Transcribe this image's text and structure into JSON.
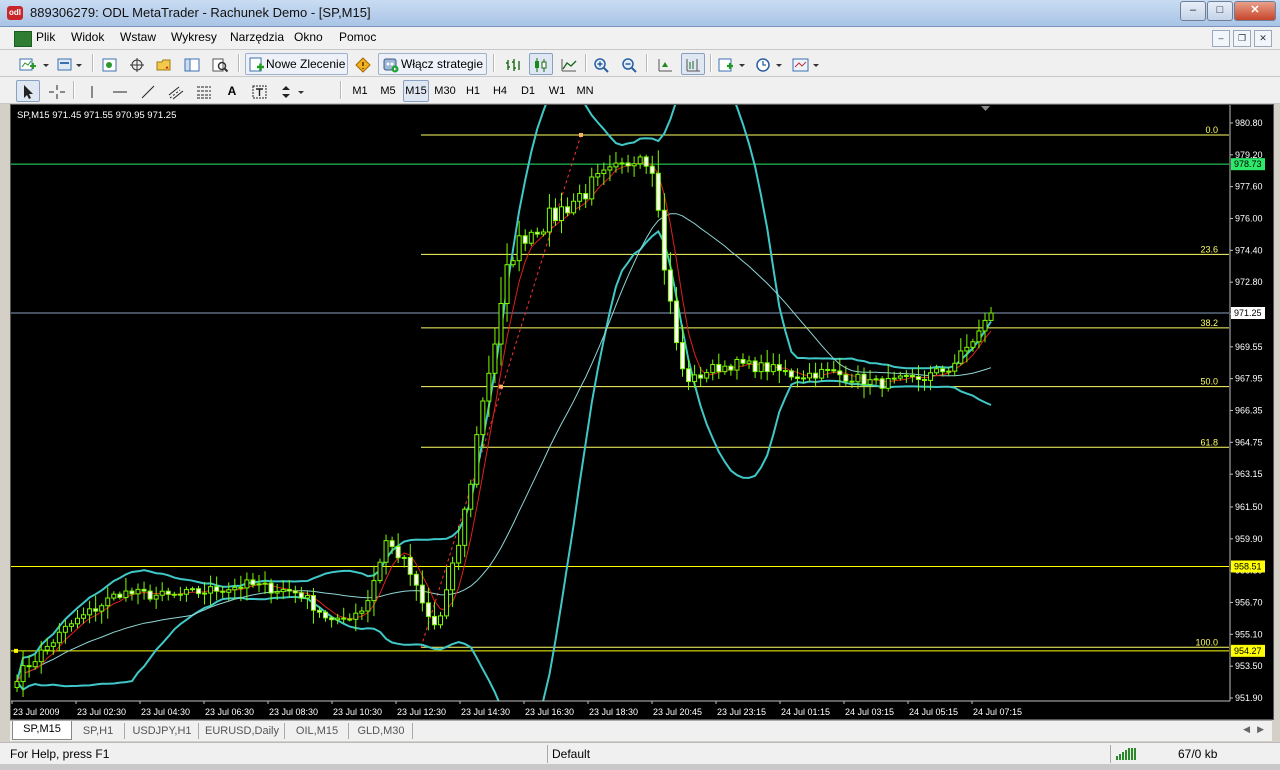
{
  "window": {
    "title": "889306279: ODL MetaTrader - Rachunek Demo - [SP,M15]",
    "icon": "metatrader-app-icon"
  },
  "menu": {
    "items": [
      "Plik",
      "Widok",
      "Wstaw",
      "Wykresy",
      "Narzędzia",
      "Okno",
      "Pomoc"
    ]
  },
  "toolbar1": {
    "new_order": "Nowe Zlecenie",
    "strategies": "Włącz strategie"
  },
  "toolbar2": {
    "timeframes": [
      "M1",
      "M5",
      "M15",
      "M30",
      "H1",
      "H4",
      "D1",
      "W1",
      "MN"
    ],
    "active_timeframe": "M15",
    "tool_text": "A"
  },
  "chart": {
    "info": "SP,M15  971.45 971.55 970.95 971.25",
    "background": "#000000",
    "candle_color": "#7cfc00",
    "bands_color": "#40c8c8",
    "ma_fast_color": "#e0201a",
    "ma_slow_color": "#8fd6d6",
    "fib_color": "#ffff66",
    "price_ticks": [
      "980.80",
      "979.20",
      "977.60",
      "976.00",
      "974.40",
      "972.80",
      "971.20",
      "969.55",
      "967.95",
      "966.35",
      "964.75",
      "963.15",
      "961.50",
      "959.90",
      "958.30",
      "956.70",
      "955.10",
      "953.50",
      "951.90"
    ],
    "price_tick_values": [
      980.8,
      979.2,
      977.6,
      976.0,
      974.4,
      972.8,
      971.2,
      969.55,
      967.95,
      966.35,
      964.75,
      963.15,
      961.5,
      959.9,
      958.3,
      956.7,
      955.1,
      953.5,
      951.9
    ],
    "time_ticks": [
      "23 Jul 2009",
      "23 Jul 02:30",
      "23 Jul 04:30",
      "23 Jul 06:30",
      "23 Jul 08:30",
      "23 Jul 10:30",
      "23 Jul 12:30",
      "23 Jul 14:30",
      "23 Jul 16:30",
      "23 Jul 18:30",
      "23 Jul 20:45",
      "23 Jul 23:15",
      "24 Jul 01:15",
      "24 Jul 03:15",
      "24 Jul 05:15",
      "24 Jul 07:15"
    ],
    "price_markers": [
      {
        "label": "978.73",
        "value": 978.73,
        "color": "#2ee86a"
      },
      {
        "label": "971.25",
        "value": 971.25,
        "color": "#ffffff"
      },
      {
        "label": "958.51",
        "value": 958.51,
        "color": "#ffff00"
      },
      {
        "label": "954.27",
        "value": 954.27,
        "color": "#ffff00"
      }
    ],
    "hlines": [
      {
        "value": 978.73,
        "color": "#2ee86a"
      },
      {
        "value": 971.25,
        "color": "#8aa0c0"
      },
      {
        "value": 958.51,
        "color": "#ffff00"
      },
      {
        "value": 954.27,
        "color": "#ffff00"
      }
    ],
    "fib_levels": [
      {
        "label": "0.0",
        "value": 980.2
      },
      {
        "label": "23.6",
        "value": 974.2
      },
      {
        "label": "38.2",
        "value": 970.5
      },
      {
        "label": "50.0",
        "value": 967.55
      },
      {
        "label": "61.8",
        "value": 964.5
      },
      {
        "label": "100.0",
        "value": 954.45
      }
    ]
  },
  "tabs": [
    "SP,M15",
    "SP,H1",
    "USDJPY,H1",
    "EURUSD,Daily",
    "OIL,M15",
    "GLD,M30"
  ],
  "active_tab": "SP,M15",
  "status": {
    "help": "For Help, press F1",
    "profile": "Default",
    "traffic": "67/0 kb"
  }
}
